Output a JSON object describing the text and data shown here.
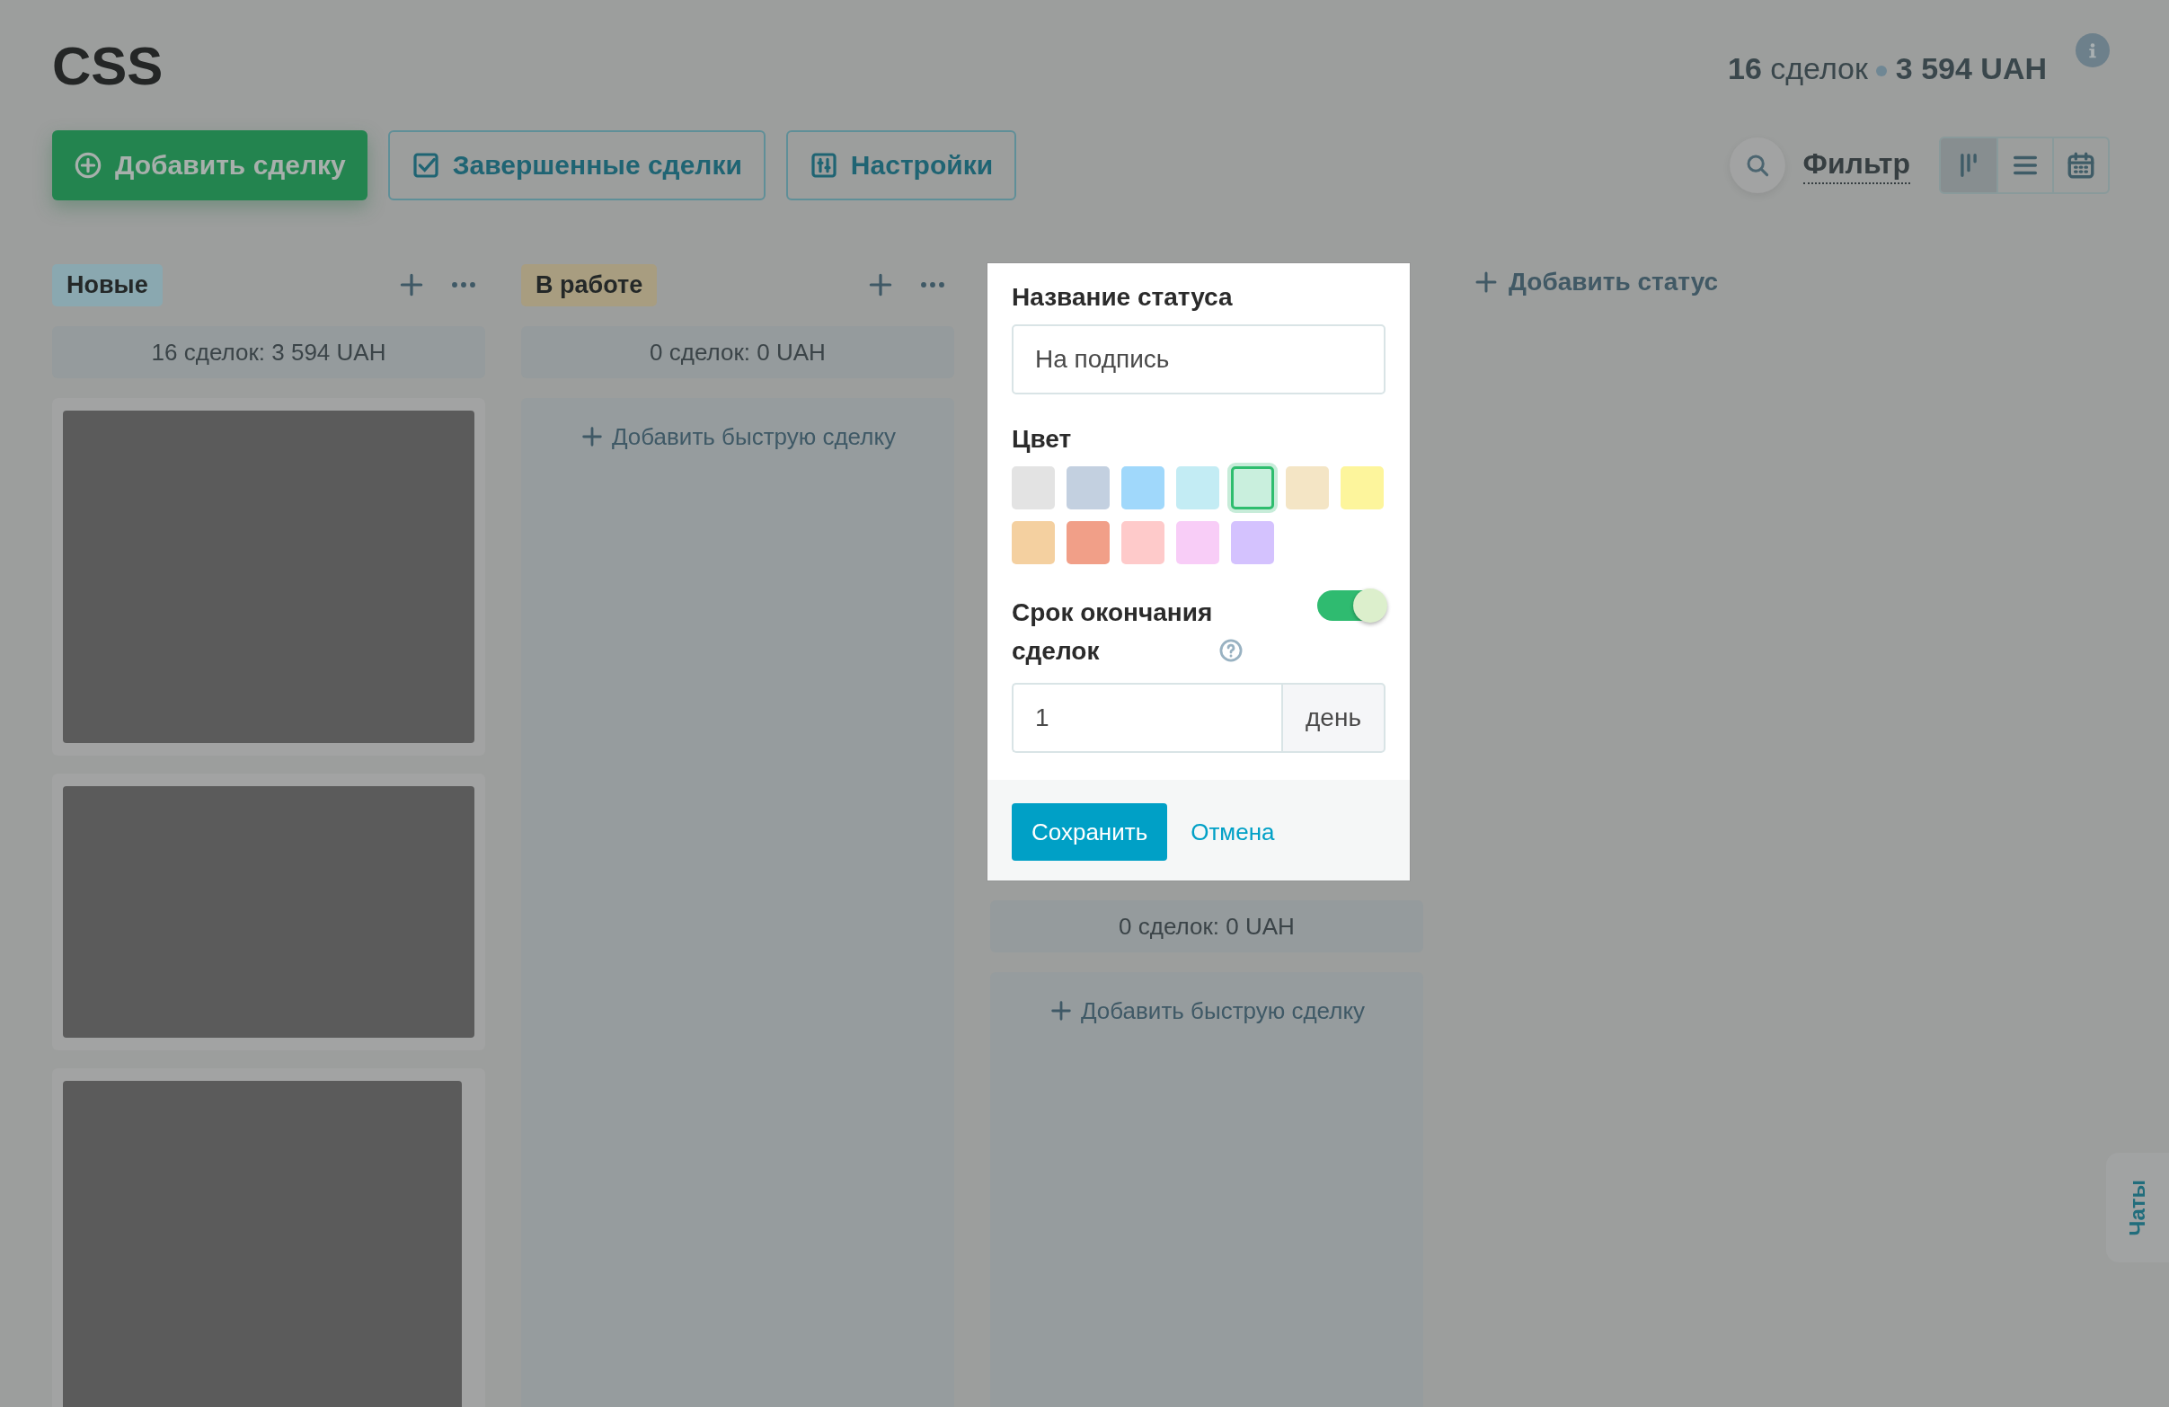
{
  "page": {
    "title": "CSS",
    "summary": {
      "count": "16",
      "count_label": "сделок",
      "amount": "3 594 UAH"
    }
  },
  "toolbar": {
    "buttons": [
      {
        "kind": "add",
        "label": "Добавить сделку"
      },
      {
        "kind": "completed",
        "label": "Завершенные сделки"
      },
      {
        "kind": "settings",
        "label": "Настройки"
      }
    ],
    "filter": {
      "label": "Фильтр"
    },
    "views": [
      {
        "kind": "board",
        "selected": true
      },
      {
        "kind": "list",
        "selected": false
      },
      {
        "kind": "calendar",
        "selected": false
      }
    ]
  },
  "columns": [
    {
      "name": "Новые",
      "color": "#8aa8b0",
      "summary": "16 сделок: 3 594 UAH",
      "cards": [
        {
          "kind": "placeholder"
        },
        {
          "kind": "placeholder"
        },
        {
          "kind": "placeholder"
        }
      ]
    },
    {
      "name": "В работе",
      "color": "#a89d80",
      "summary": "0 сделок: 0 UAH",
      "quick_add": "Добавить быструю сделку"
    },
    {
      "editor": {
        "name_label": "Название статуса",
        "name_value": "На подпись",
        "color_label": "Цвет",
        "swatches": [
          {
            "color": "#e3e3e3",
            "selected": false
          },
          {
            "color": "#c3d0e0",
            "selected": false
          },
          {
            "color": "#a0d8fb",
            "selected": false
          },
          {
            "color": "#c3ecf4",
            "selected": false
          },
          {
            "color": "#c9efdd",
            "selected": true
          },
          {
            "color": "#f4e5c5",
            "selected": false
          },
          {
            "color": "#fdf59c",
            "selected": false
          },
          {
            "color": "#f4d0a0",
            "selected": false
          },
          {
            "color": "#f19f88",
            "selected": false
          },
          {
            "color": "#fecaca",
            "selected": false
          },
          {
            "color": "#f8cdf7",
            "selected": false
          },
          {
            "color": "#d4c2fe",
            "selected": false
          }
        ],
        "deadline": {
          "label": "Срок окончания сделок",
          "on": true,
          "value": "1",
          "unit": "день"
        },
        "save": "Сохранить",
        "cancel": "Отмена"
      },
      "summary": "0 сделок: 0 UAH",
      "quick_add": "Добавить быструю сделку"
    }
  ],
  "add_status": "Добавить статус",
  "chat_tab": "Чаты"
}
